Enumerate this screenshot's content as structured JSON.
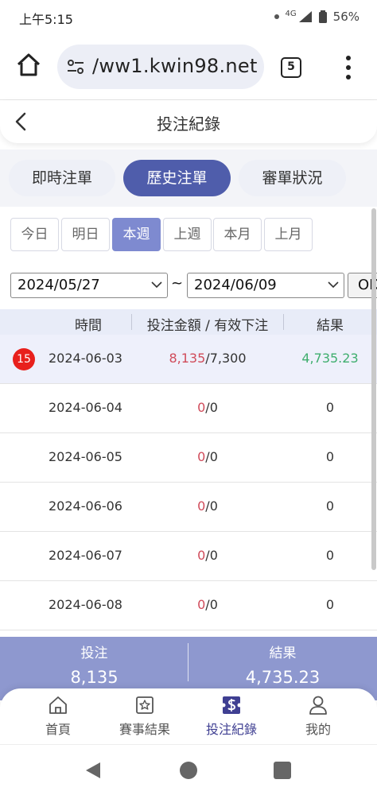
{
  "status_bar": {
    "time": "上午5:15",
    "network": "4G",
    "battery": "56%"
  },
  "browser": {
    "url": "/ww1.kwin98.net",
    "tab_count": "5"
  },
  "page": {
    "title": "投注紀錄"
  },
  "segments": [
    {
      "label": "即時注單",
      "active": false
    },
    {
      "label": "歷史注單",
      "active": true
    },
    {
      "label": "審單狀況",
      "active": false
    }
  ],
  "ranges": [
    {
      "label": "今日",
      "active": false
    },
    {
      "label": "明日",
      "active": false
    },
    {
      "label": "本週",
      "active": true
    },
    {
      "label": "上週",
      "active": false
    },
    {
      "label": "本月",
      "active": false
    },
    {
      "label": "上月",
      "active": false
    }
  ],
  "filter": {
    "start_date": "2024/05/27",
    "separator": "~",
    "end_date": "2024/06/09",
    "ok_label": "OK"
  },
  "table": {
    "headers": {
      "time": "時間",
      "amount": "投注金額 / 有效下注",
      "result": "結果"
    },
    "rows": [
      {
        "badge": "15",
        "date": "2024-06-03",
        "bet": "8,135",
        "valid": "/7,300",
        "result": "4,735.23"
      },
      {
        "date": "2024-06-04",
        "bet": "0",
        "valid": "/0",
        "result": "0"
      },
      {
        "date": "2024-06-05",
        "bet": "0",
        "valid": "/0",
        "result": "0"
      },
      {
        "date": "2024-06-06",
        "bet": "0",
        "valid": "/0",
        "result": "0"
      },
      {
        "date": "2024-06-07",
        "bet": "0",
        "valid": "/0",
        "result": "0"
      },
      {
        "date": "2024-06-08",
        "bet": "0",
        "valid": "/0",
        "result": "0"
      }
    ]
  },
  "summary": {
    "bet_label": "投注",
    "bet_value": "8,135",
    "result_label": "結果",
    "result_value": "4,735.23"
  },
  "bottom_nav": [
    {
      "label": "首頁",
      "icon": "home-icon"
    },
    {
      "label": "賽事結果",
      "icon": "star-board-icon"
    },
    {
      "label": "投注紀錄",
      "icon": "bet-record-icon",
      "active": true
    },
    {
      "label": "我的",
      "icon": "user-icon"
    }
  ],
  "colors": {
    "accent": "#4f5dab",
    "chip_active": "#7e8ad0",
    "summary_bg": "#8e98cf",
    "bet_red": "#d04b5a",
    "win_green": "#3fae6e",
    "badge_red": "#e8201c"
  }
}
